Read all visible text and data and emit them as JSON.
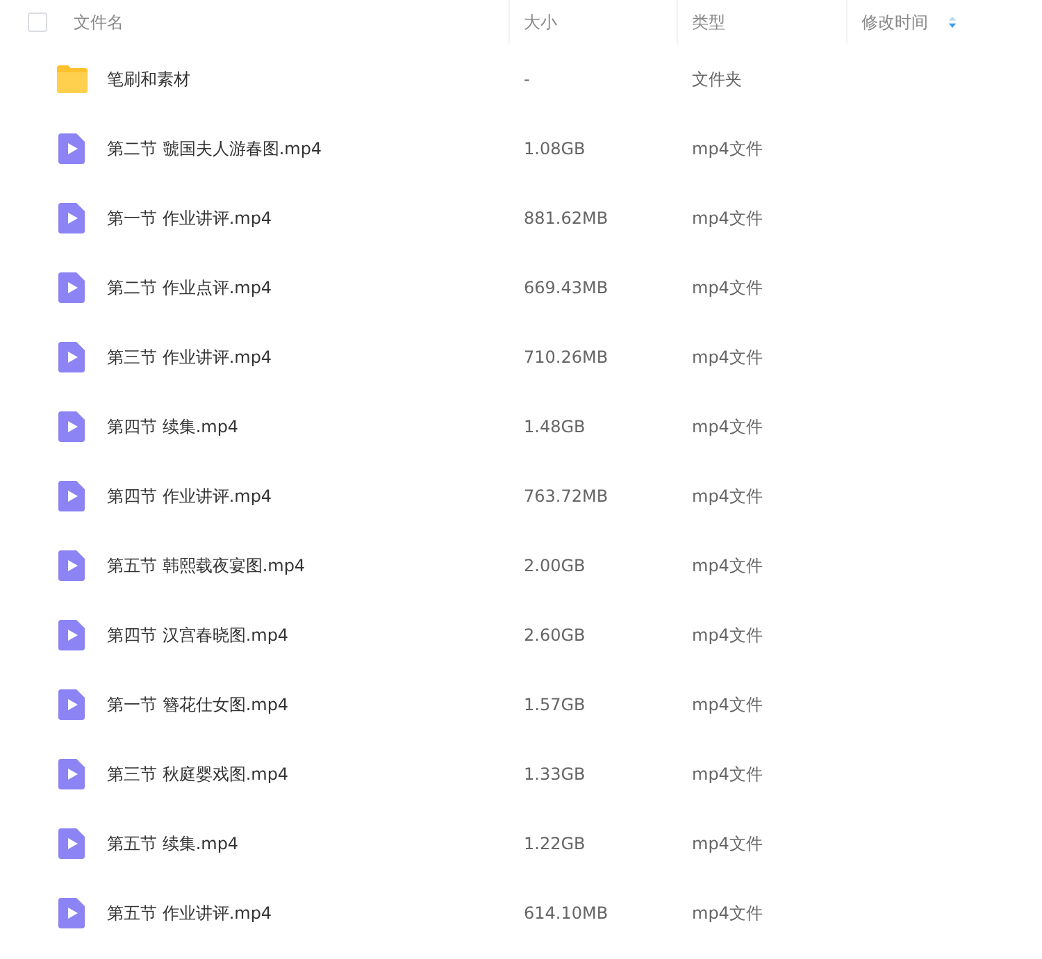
{
  "header": {
    "select_all": {
      "checked": false
    },
    "columns": [
      {
        "label": "文件名",
        "sorted": false
      },
      {
        "label": "大小",
        "sorted": false
      },
      {
        "label": "类型",
        "sorted": false
      },
      {
        "label": "修改时间",
        "sorted": true
      }
    ]
  },
  "files": [
    {
      "kind": "folder",
      "name": "笔刷和素材",
      "size": "-",
      "type": "文件夹"
    },
    {
      "kind": "video",
      "name": "第二节 虢国夫人游春图.mp4",
      "size": "1.08GB",
      "type": "mp4文件"
    },
    {
      "kind": "video",
      "name": "第一节 作业讲评.mp4",
      "size": "881.62MB",
      "type": "mp4文件"
    },
    {
      "kind": "video",
      "name": "第二节 作业点评.mp4",
      "size": "669.43MB",
      "type": "mp4文件"
    },
    {
      "kind": "video",
      "name": "第三节 作业讲评.mp4",
      "size": "710.26MB",
      "type": "mp4文件"
    },
    {
      "kind": "video",
      "name": "第四节 续集.mp4",
      "size": "1.48GB",
      "type": "mp4文件"
    },
    {
      "kind": "video",
      "name": "第四节 作业讲评.mp4",
      "size": "763.72MB",
      "type": "mp4文件"
    },
    {
      "kind": "video",
      "name": "第五节 韩熙载夜宴图.mp4",
      "size": "2.00GB",
      "type": "mp4文件"
    },
    {
      "kind": "video",
      "name": "第四节 汉宫春晓图.mp4",
      "size": "2.60GB",
      "type": "mp4文件"
    },
    {
      "kind": "video",
      "name": "第一节 簪花仕女图.mp4",
      "size": "1.57GB",
      "type": "mp4文件"
    },
    {
      "kind": "video",
      "name": "第三节 秋庭婴戏图.mp4",
      "size": "1.33GB",
      "type": "mp4文件"
    },
    {
      "kind": "video",
      "name": "第五节 续集.mp4",
      "size": "1.22GB",
      "type": "mp4文件"
    },
    {
      "kind": "video",
      "name": "第五节 作业讲评.mp4",
      "size": "614.10MB",
      "type": "mp4文件"
    }
  ]
}
